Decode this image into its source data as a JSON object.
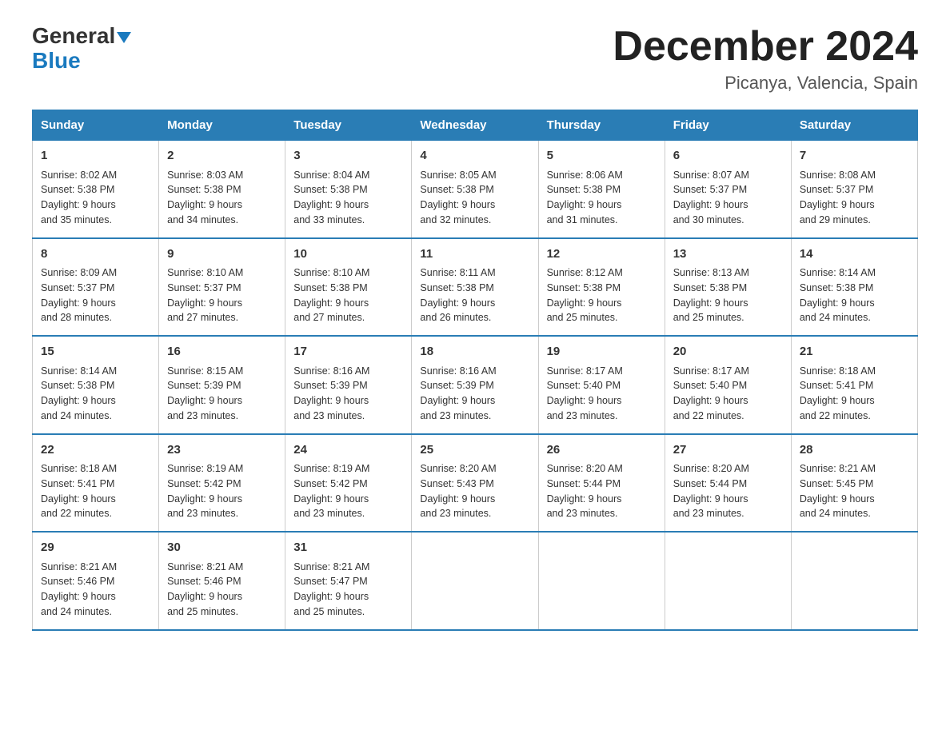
{
  "header": {
    "logo_general": "General",
    "logo_blue": "Blue",
    "month_title": "December 2024",
    "location": "Picanya, Valencia, Spain"
  },
  "days_of_week": [
    "Sunday",
    "Monday",
    "Tuesday",
    "Wednesday",
    "Thursday",
    "Friday",
    "Saturday"
  ],
  "weeks": [
    [
      {
        "num": "1",
        "sunrise": "8:02 AM",
        "sunset": "5:38 PM",
        "daylight": "9 hours and 35 minutes."
      },
      {
        "num": "2",
        "sunrise": "8:03 AM",
        "sunset": "5:38 PM",
        "daylight": "9 hours and 34 minutes."
      },
      {
        "num": "3",
        "sunrise": "8:04 AM",
        "sunset": "5:38 PM",
        "daylight": "9 hours and 33 minutes."
      },
      {
        "num": "4",
        "sunrise": "8:05 AM",
        "sunset": "5:38 PM",
        "daylight": "9 hours and 32 minutes."
      },
      {
        "num": "5",
        "sunrise": "8:06 AM",
        "sunset": "5:38 PM",
        "daylight": "9 hours and 31 minutes."
      },
      {
        "num": "6",
        "sunrise": "8:07 AM",
        "sunset": "5:37 PM",
        "daylight": "9 hours and 30 minutes."
      },
      {
        "num": "7",
        "sunrise": "8:08 AM",
        "sunset": "5:37 PM",
        "daylight": "9 hours and 29 minutes."
      }
    ],
    [
      {
        "num": "8",
        "sunrise": "8:09 AM",
        "sunset": "5:37 PM",
        "daylight": "9 hours and 28 minutes."
      },
      {
        "num": "9",
        "sunrise": "8:10 AM",
        "sunset": "5:37 PM",
        "daylight": "9 hours and 27 minutes."
      },
      {
        "num": "10",
        "sunrise": "8:10 AM",
        "sunset": "5:38 PM",
        "daylight": "9 hours and 27 minutes."
      },
      {
        "num": "11",
        "sunrise": "8:11 AM",
        "sunset": "5:38 PM",
        "daylight": "9 hours and 26 minutes."
      },
      {
        "num": "12",
        "sunrise": "8:12 AM",
        "sunset": "5:38 PM",
        "daylight": "9 hours and 25 minutes."
      },
      {
        "num": "13",
        "sunrise": "8:13 AM",
        "sunset": "5:38 PM",
        "daylight": "9 hours and 25 minutes."
      },
      {
        "num": "14",
        "sunrise": "8:14 AM",
        "sunset": "5:38 PM",
        "daylight": "9 hours and 24 minutes."
      }
    ],
    [
      {
        "num": "15",
        "sunrise": "8:14 AM",
        "sunset": "5:38 PM",
        "daylight": "9 hours and 24 minutes."
      },
      {
        "num": "16",
        "sunrise": "8:15 AM",
        "sunset": "5:39 PM",
        "daylight": "9 hours and 23 minutes."
      },
      {
        "num": "17",
        "sunrise": "8:16 AM",
        "sunset": "5:39 PM",
        "daylight": "9 hours and 23 minutes."
      },
      {
        "num": "18",
        "sunrise": "8:16 AM",
        "sunset": "5:39 PM",
        "daylight": "9 hours and 23 minutes."
      },
      {
        "num": "19",
        "sunrise": "8:17 AM",
        "sunset": "5:40 PM",
        "daylight": "9 hours and 23 minutes."
      },
      {
        "num": "20",
        "sunrise": "8:17 AM",
        "sunset": "5:40 PM",
        "daylight": "9 hours and 22 minutes."
      },
      {
        "num": "21",
        "sunrise": "8:18 AM",
        "sunset": "5:41 PM",
        "daylight": "9 hours and 22 minutes."
      }
    ],
    [
      {
        "num": "22",
        "sunrise": "8:18 AM",
        "sunset": "5:41 PM",
        "daylight": "9 hours and 22 minutes."
      },
      {
        "num": "23",
        "sunrise": "8:19 AM",
        "sunset": "5:42 PM",
        "daylight": "9 hours and 23 minutes."
      },
      {
        "num": "24",
        "sunrise": "8:19 AM",
        "sunset": "5:42 PM",
        "daylight": "9 hours and 23 minutes."
      },
      {
        "num": "25",
        "sunrise": "8:20 AM",
        "sunset": "5:43 PM",
        "daylight": "9 hours and 23 minutes."
      },
      {
        "num": "26",
        "sunrise": "8:20 AM",
        "sunset": "5:44 PM",
        "daylight": "9 hours and 23 minutes."
      },
      {
        "num": "27",
        "sunrise": "8:20 AM",
        "sunset": "5:44 PM",
        "daylight": "9 hours and 23 minutes."
      },
      {
        "num": "28",
        "sunrise": "8:21 AM",
        "sunset": "5:45 PM",
        "daylight": "9 hours and 24 minutes."
      }
    ],
    [
      {
        "num": "29",
        "sunrise": "8:21 AM",
        "sunset": "5:46 PM",
        "daylight": "9 hours and 24 minutes."
      },
      {
        "num": "30",
        "sunrise": "8:21 AM",
        "sunset": "5:46 PM",
        "daylight": "9 hours and 25 minutes."
      },
      {
        "num": "31",
        "sunrise": "8:21 AM",
        "sunset": "5:47 PM",
        "daylight": "9 hours and 25 minutes."
      },
      null,
      null,
      null,
      null
    ]
  ],
  "labels": {
    "sunrise": "Sunrise:",
    "sunset": "Sunset:",
    "daylight": "Daylight:"
  }
}
